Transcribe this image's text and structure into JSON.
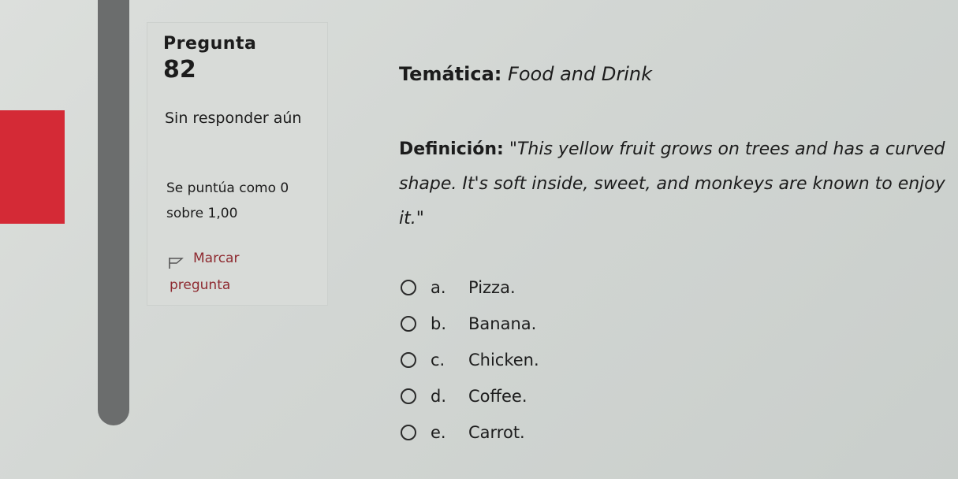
{
  "question": {
    "label": "Pregunta",
    "number": "82",
    "status": "Sin responder aún",
    "score": "Se puntúa como 0 sobre 1,00",
    "flag_label_1": "Marcar",
    "flag_label_2": "pregunta",
    "flag_icon": "flag-outline-icon"
  },
  "content": {
    "topic_label": "Temática:",
    "topic_value": "Food and Drink",
    "definition_label": "Definición:",
    "definition_text": "\"This yellow fruit grows on trees and has a curved shape. It's soft inside, sweet, and monkeys are known to enjoy it.\""
  },
  "options": [
    {
      "letter": "a.",
      "text": "Pizza."
    },
    {
      "letter": "b.",
      "text": "Banana."
    },
    {
      "letter": "c.",
      "text": "Chicken."
    },
    {
      "letter": "d.",
      "text": "Coffee."
    },
    {
      "letter": "e.",
      "text": "Carrot."
    }
  ],
  "colors": {
    "accent_red": "#d42a36",
    "flag_text": "#8e2a30",
    "scrollbar": "#6b6d6d"
  }
}
